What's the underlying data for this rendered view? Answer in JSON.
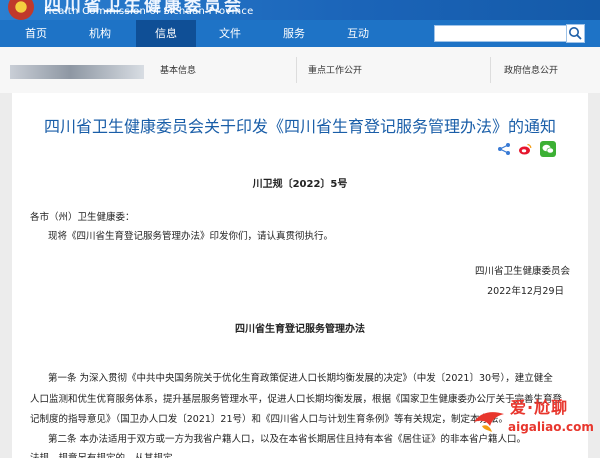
{
  "header": {
    "site_title_cn": "四川省卫生健康委员会",
    "site_title_en": "Health Commission of Sichuan Province"
  },
  "nav": {
    "items": [
      {
        "label": "首页"
      },
      {
        "label": "机构"
      },
      {
        "label": "信息"
      },
      {
        "label": "文件"
      },
      {
        "label": "服务"
      },
      {
        "label": "互动"
      }
    ],
    "active_index": 2,
    "search": {
      "placeholder": ""
    }
  },
  "subheader": {
    "basic_info_label": "基本信息",
    "key_info_label": "重点工作公开",
    "gov_info_label": "政府信息公开"
  },
  "article": {
    "title": "四川省卫生健康委员会关于印发《四川省生育登记服务管理办法》的通知",
    "doc_number": "川卫规〔2022〕5号",
    "recipient": "各市（州）卫生健康委：",
    "body_intro": "现将《四川省生育登记服务管理办法》印发你们，请认真贯彻执行。",
    "signature_org": "四川省卫生健康委员会",
    "signature_date": "2022年12月29日",
    "subtitle": "四川省生育登记服务管理办法",
    "paragraphs": [
      "第一条  为深入贯彻《中共中央国务院关于优化生育政策促进人口长期均衡发展的决定》（中发〔2021〕30号），建立健全",
      "人口监测和优生优育服务体系，提升基层服务管理水平，促进人口长期均衡发展，根据《国家卫生健康委办公厅关于完善生育登",
      "记制度的指导意见》（国卫办人口发〔2021〕21号）和《四川省人口与计划生育条例》等有关规定，制定本办法。",
      "第二条  本办法适用于双方或一方为我省户籍人口，以及在本省长期居住且持有本省《居住证》的非本省户籍人口。",
      "法规、规章另有规定的，从其规定。"
    ]
  },
  "watermark": {
    "text_cn": "爱·尬聊",
    "url": "aigaliao.com"
  },
  "colors": {
    "nav_bg": "#1e73c6",
    "nav_active": "#0f4f96",
    "title": "#1a5ea8",
    "weibo": "#e6162d",
    "wechat": "#3cb034",
    "watermark": "#e8362d"
  }
}
